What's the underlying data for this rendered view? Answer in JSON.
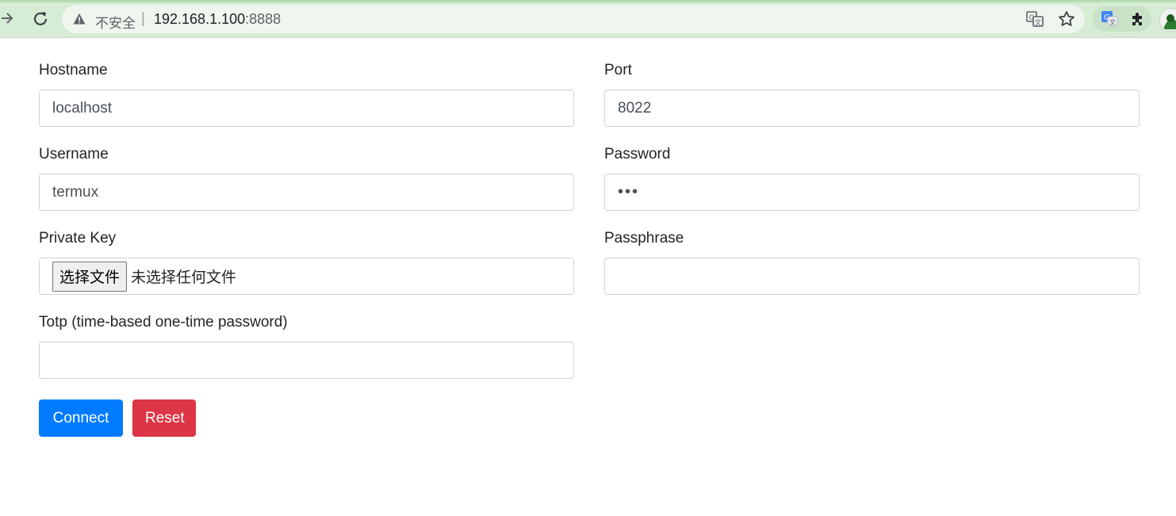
{
  "browser": {
    "security_label": "不安全",
    "separator": "|",
    "url_host": "192.168.1.100",
    "url_port": ":8888"
  },
  "form": {
    "hostname": {
      "label": "Hostname",
      "value": "localhost"
    },
    "port": {
      "label": "Port",
      "value": "8022"
    },
    "username": {
      "label": "Username",
      "value": "termux"
    },
    "password": {
      "label": "Password",
      "value": "•••"
    },
    "private_key": {
      "label": "Private Key",
      "button_label": "选择文件",
      "status": "未选择任何文件"
    },
    "passphrase": {
      "label": "Passphrase",
      "value": ""
    },
    "totp": {
      "label": "Totp (time-based one-time password)",
      "value": ""
    },
    "buttons": {
      "connect": "Connect",
      "reset": "Reset"
    }
  },
  "colors": {
    "primary": "#007bff",
    "danger": "#dc3545",
    "chrome": "#d6ecd4"
  }
}
